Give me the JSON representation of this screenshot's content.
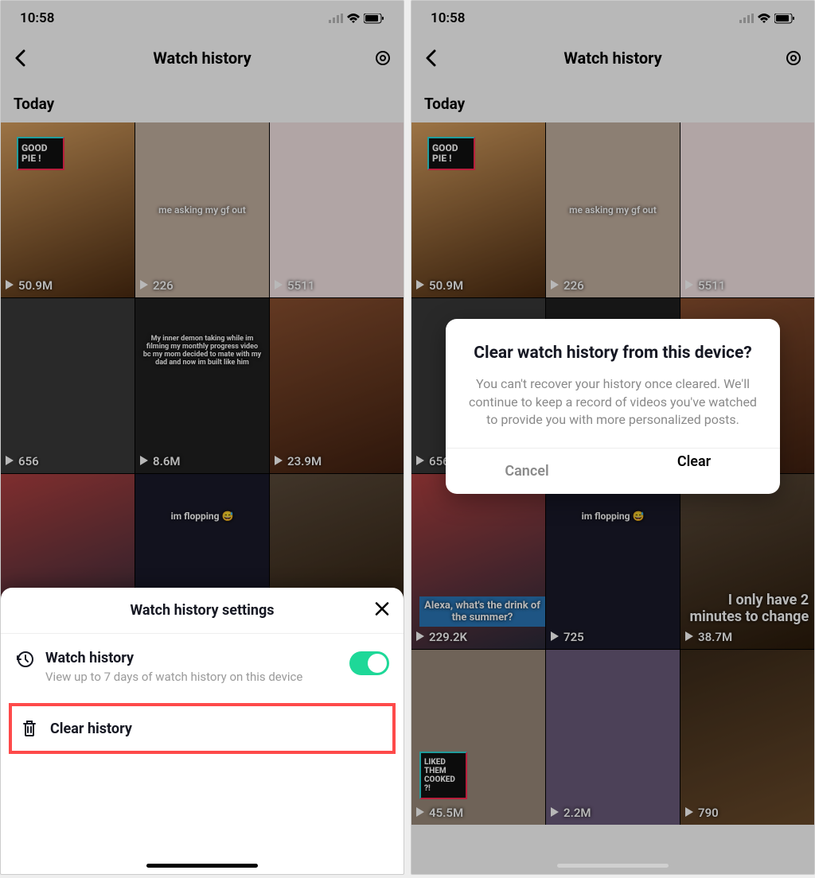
{
  "status_bar": {
    "time": "10:58"
  },
  "nav": {
    "title": "Watch history"
  },
  "section_today": "Today",
  "tiles": [
    {
      "views": "50.9M",
      "badge": "GOOD PIE !"
    },
    {
      "views": "226",
      "caption": "me asking my gf out"
    },
    {
      "views": "5511"
    },
    {
      "views": "656"
    },
    {
      "views": "8.6M",
      "caption": "My inner demon taking while im filming my monthly progress video bc my mom decided to mate with my dad and now im built like him"
    },
    {
      "views": "23.9M"
    },
    {
      "views": "229.2K",
      "caption": "Alexa, what's the drink of the summer?"
    },
    {
      "views": "725",
      "caption": "im flopping 😅"
    },
    {
      "views": "38.7M",
      "ctext": "I only have 2 minutes to change"
    },
    {
      "views": "45.5M",
      "badge": "LIKED THEM COOKED ?!"
    },
    {
      "views": "2.2M"
    },
    {
      "views": "790"
    }
  ],
  "sheet": {
    "title": "Watch history settings",
    "row_title": "Watch history",
    "row_sub": "View up to 7 days of watch history on this device",
    "clear": "Clear history"
  },
  "dialog": {
    "title": "Clear watch history from this device?",
    "text": "You can't recover your history once cleared. We'll continue to keep a record of videos you've watched to provide you with more personalized posts.",
    "cancel": "Cancel",
    "clear": "Clear"
  }
}
